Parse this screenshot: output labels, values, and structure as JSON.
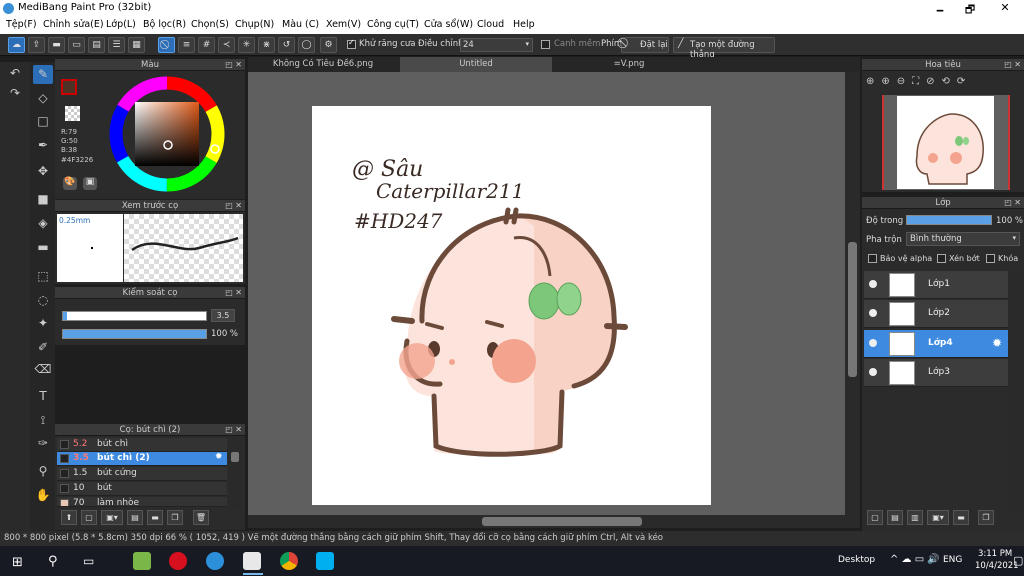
{
  "window": {
    "title": "MediBang Paint Pro (32bit)",
    "minimize": "🗕",
    "maximize": "🗗",
    "close": "✕"
  },
  "menu": [
    "Tệp(F)",
    "Chỉnh sửa(E)",
    "Lớp(L)",
    "Bộ lọc(R)",
    "Chọn(S)",
    "Chụp(N)",
    "Màu (C)",
    "Xem(V)",
    "Công cụ(T)",
    "Cửa sổ(W)",
    "Cloud",
    "Help"
  ],
  "toolbar": {
    "antialias_label": "Khử răng cưa",
    "adjust_label": "Điều chỉnh",
    "adjust_value": "24",
    "edge_label": "Canh mềm",
    "key_label": "Phím",
    "reset_label": "Đặt lại",
    "straight_label": "Tạo một đường thẳng"
  },
  "color_panel": {
    "title": "Màu",
    "r": "R:79",
    "g": "G:50",
    "b": "B:38",
    "hex": "#4F3226",
    "fg": "#4F3226"
  },
  "brush_preview": {
    "title": "Xem trước cọ",
    "size": "0.25mm"
  },
  "brush_control": {
    "title": "Kiểm soát cọ",
    "size": "3.5",
    "opacity": "100 %",
    "size_frac": 0.03,
    "opacity_frac": 1.0
  },
  "brush_list": {
    "title": "Cọ: bút chì (2)",
    "items": [
      {
        "size": "5.2",
        "name": "bút chì"
      },
      {
        "size": "3.5",
        "name": "bút chì (2)"
      },
      {
        "size": "1.5",
        "name": "bút cứng"
      },
      {
        "size": "10",
        "name": "bút"
      },
      {
        "size": "70",
        "name": "làm nhòe"
      }
    ]
  },
  "tabs": [
    "Không Có Tiêu Đề6.png",
    "Untitled",
    "=V.png"
  ],
  "navigator": {
    "title": "Hoa tiêu"
  },
  "layers": {
    "title": "Lớp",
    "opacity_label": "Độ trong",
    "opacity_value": "100 %",
    "blend_label": "Pha trộn",
    "blend_value": "Bình thường",
    "protect_alpha": "Bảo vệ alpha",
    "clip": "Xén bớt",
    "lock": "Khóa",
    "items": [
      "Lớp1",
      "Lớp2",
      "Lớp4",
      "Lớp3"
    ]
  },
  "artwork": {
    "line1": "@ Sâu",
    "line2": "Caterpillar211",
    "line3": "#HD247"
  },
  "status": {
    "text": "800 * 800 pixel  (5.8 * 5.8cm)  350 dpi  66 %  ( 1052, 419 )  Vẽ một đường thẳng bằng cách giữ phím Shift, Thay đổi cỡ cọ bằng cách giữ phím Ctrl, Alt và kéo"
  },
  "taskbar": {
    "desktop": "Desktop",
    "lang": "ENG",
    "time": "3:11 PM",
    "date": "10/4/2021"
  }
}
